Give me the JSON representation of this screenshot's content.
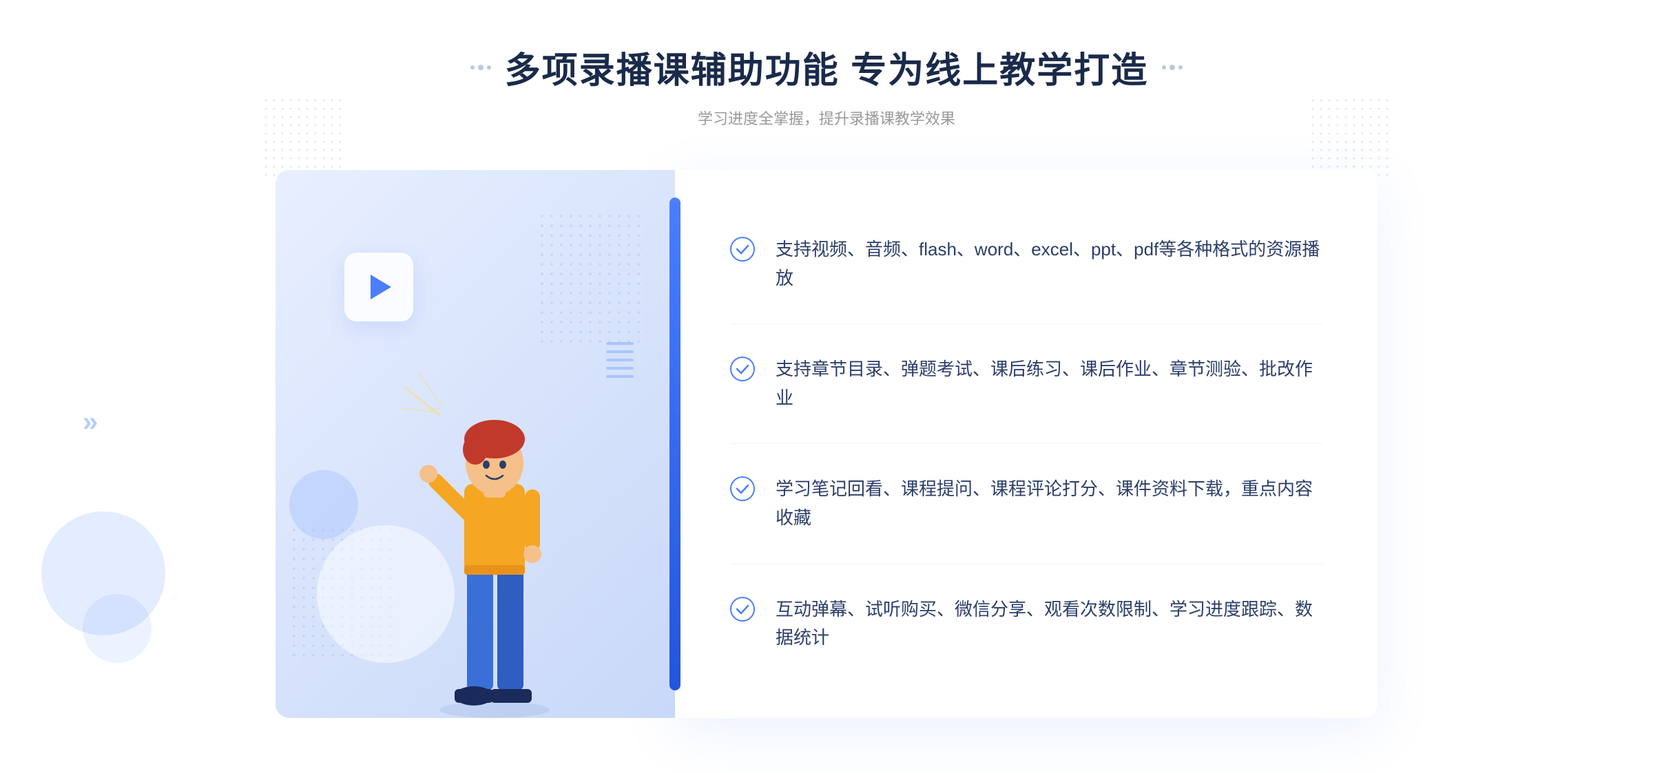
{
  "header": {
    "title": "多项录播课辅助功能 专为线上教学打造",
    "subtitle": "学习进度全掌握，提升录播课教学效果"
  },
  "features": [
    {
      "id": 1,
      "text": "支持视频、音频、flash、word、excel、ppt、pdf等各种格式的资源播放"
    },
    {
      "id": 2,
      "text": "支持章节目录、弹题考试、课后练习、课后作业、章节测验、批改作业"
    },
    {
      "id": 3,
      "text": "学习笔记回看、课程提问、课程评论打分、课件资料下载，重点内容收藏"
    },
    {
      "id": 4,
      "text": "互动弹幕、试听购买、微信分享、观看次数限制、学习进度跟踪、数据统计"
    }
  ],
  "decorations": {
    "chevrons_symbol": "»",
    "title_dots_count": 3
  }
}
